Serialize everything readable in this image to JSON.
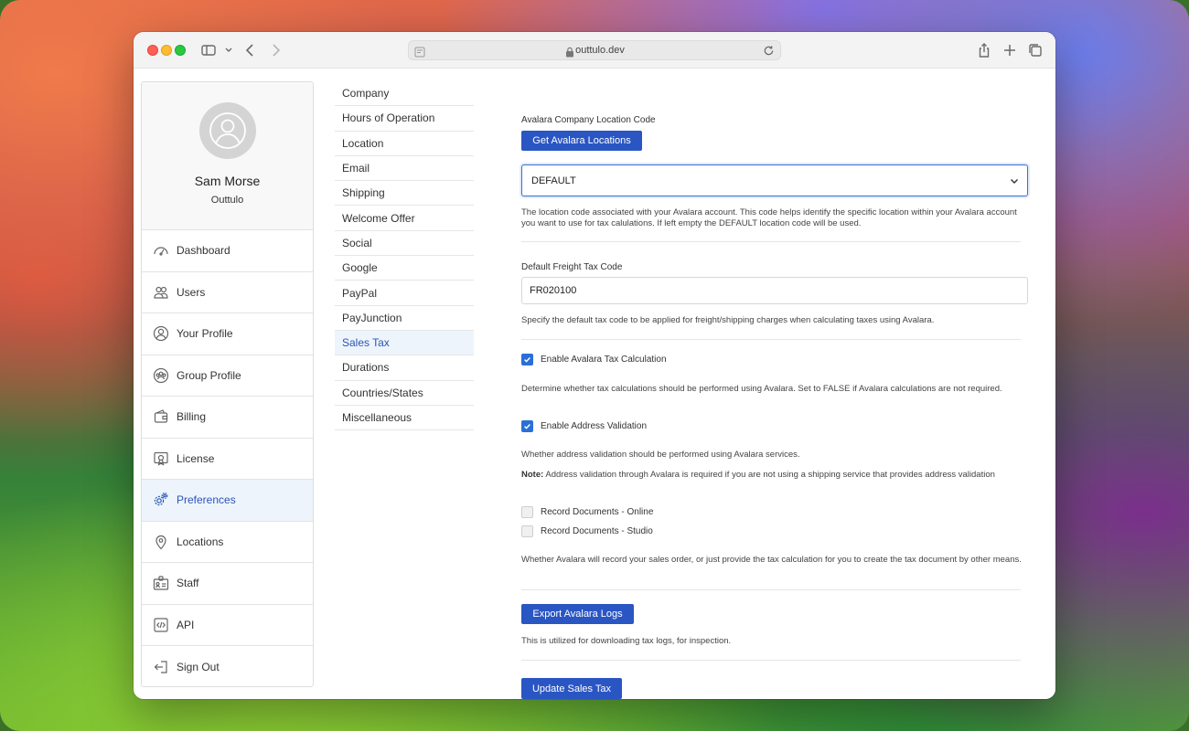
{
  "browser": {
    "url": "outtulo.dev"
  },
  "profile": {
    "name": "Sam Morse",
    "org": "Outtulo"
  },
  "sidebar": {
    "items": [
      {
        "label": "Dashboard",
        "icon": "gauge-icon"
      },
      {
        "label": "Users",
        "icon": "users-icon"
      },
      {
        "label": "Your Profile",
        "icon": "user-circle-icon"
      },
      {
        "label": "Group Profile",
        "icon": "group-icon"
      },
      {
        "label": "Billing",
        "icon": "wallet-icon"
      },
      {
        "label": "License",
        "icon": "certificate-icon"
      },
      {
        "label": "Preferences",
        "icon": "gears-icon",
        "active": true
      },
      {
        "label": "Locations",
        "icon": "map-pin-icon"
      },
      {
        "label": "Staff",
        "icon": "id-badge-icon"
      },
      {
        "label": "API",
        "icon": "code-icon"
      },
      {
        "label": "Sign Out",
        "icon": "sign-out-icon"
      }
    ]
  },
  "submenu": {
    "items": [
      "Company",
      "Hours of Operation",
      "Location",
      "Email",
      "Shipping",
      "Welcome Offer",
      "Social",
      "Google",
      "PayPal",
      "PayJunction",
      "Sales Tax",
      "Durations",
      "Countries/States",
      "Miscellaneous"
    ],
    "active": "Sales Tax"
  },
  "form": {
    "location_code_label": "Avalara Company Location Code",
    "get_locations_button": "Get Avalara Locations",
    "location_select_value": "DEFAULT",
    "location_help": "The location code associated with your Avalara account. This code helps identify the specific location within your Avalara account you want to use for tax calulations. If left empty the DEFAULT location code will be used.",
    "freight_label": "Default Freight Tax Code",
    "freight_value": "FR020100",
    "freight_help": "Specify the default tax code to be applied for freight/shipping charges when calculating taxes using Avalara.",
    "enable_tax_label": "Enable Avalara Tax Calculation",
    "enable_tax_checked": true,
    "enable_tax_help": "Determine whether tax calculations should be performed using Avalara. Set to FALSE if Avalara calculations are not required.",
    "address_validation_label": "Enable Address Validation",
    "address_validation_checked": true,
    "address_validation_help": "Whether address validation should be performed using Avalara services.",
    "note_label": "Note:",
    "note_text": "Address validation through Avalara is required if you are not using a shipping service that provides address validation",
    "record_online_label": "Record Documents - Online",
    "record_online_checked": false,
    "record_studio_label": "Record Documents - Studio",
    "record_studio_checked": false,
    "record_help": "Whether Avalara will record your sales order, or just provide the tax calculation for you to create the tax document by other means.",
    "export_logs_button": "Export Avalara Logs",
    "export_help": "This is utilized for downloading tax logs, for inspection.",
    "update_button": "Update Sales Tax"
  },
  "colors": {
    "accent": "#2a56c4",
    "active_bg": "#eef4fb",
    "checkbox_on": "#2a6fd8"
  }
}
